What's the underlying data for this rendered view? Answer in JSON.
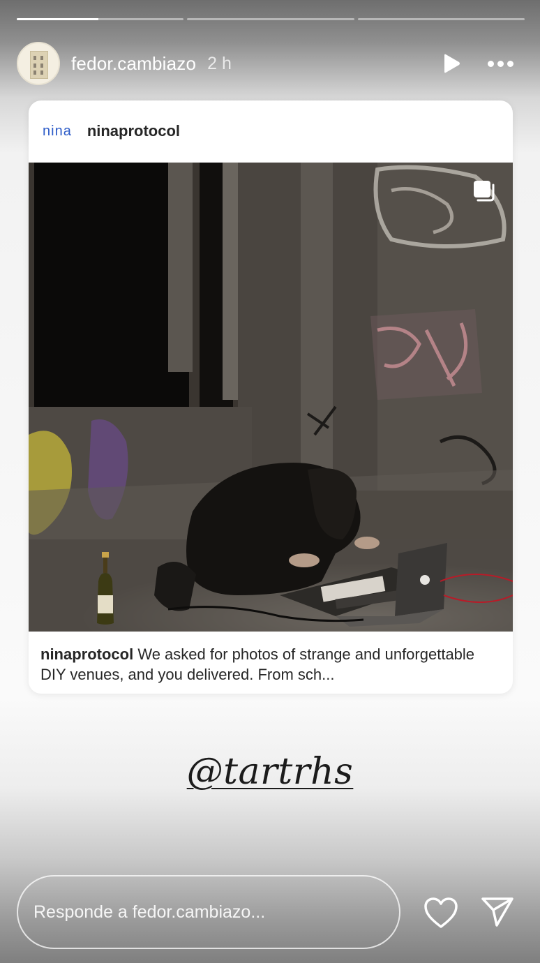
{
  "progress": {
    "segments": 3,
    "current_segment_fill": 0.49
  },
  "header": {
    "username": "fedor.cambiazo",
    "time": "2 h",
    "play_icon": "play-icon",
    "more_icon": "more-horizontal-icon"
  },
  "post": {
    "logo_text": "nina",
    "account": "ninaprotocol",
    "photo_description": "dark photo of a person hunched over music equipment and a laptop in a graffiti-covered abandoned building, with a wine bottle nearby",
    "multi_image_icon": "carousel-icon",
    "caption_user": "ninaprotocol",
    "caption_text": "We asked for photos of strange and unforgettable DIY venues, and you delivered. From sch..."
  },
  "mention": "@tartrhs",
  "reply": {
    "placeholder": "Responde a fedor.cambiazo..."
  },
  "colors": {
    "nina_blue": "#2d5cc8",
    "text_dark": "#262626",
    "white": "#ffffff"
  }
}
